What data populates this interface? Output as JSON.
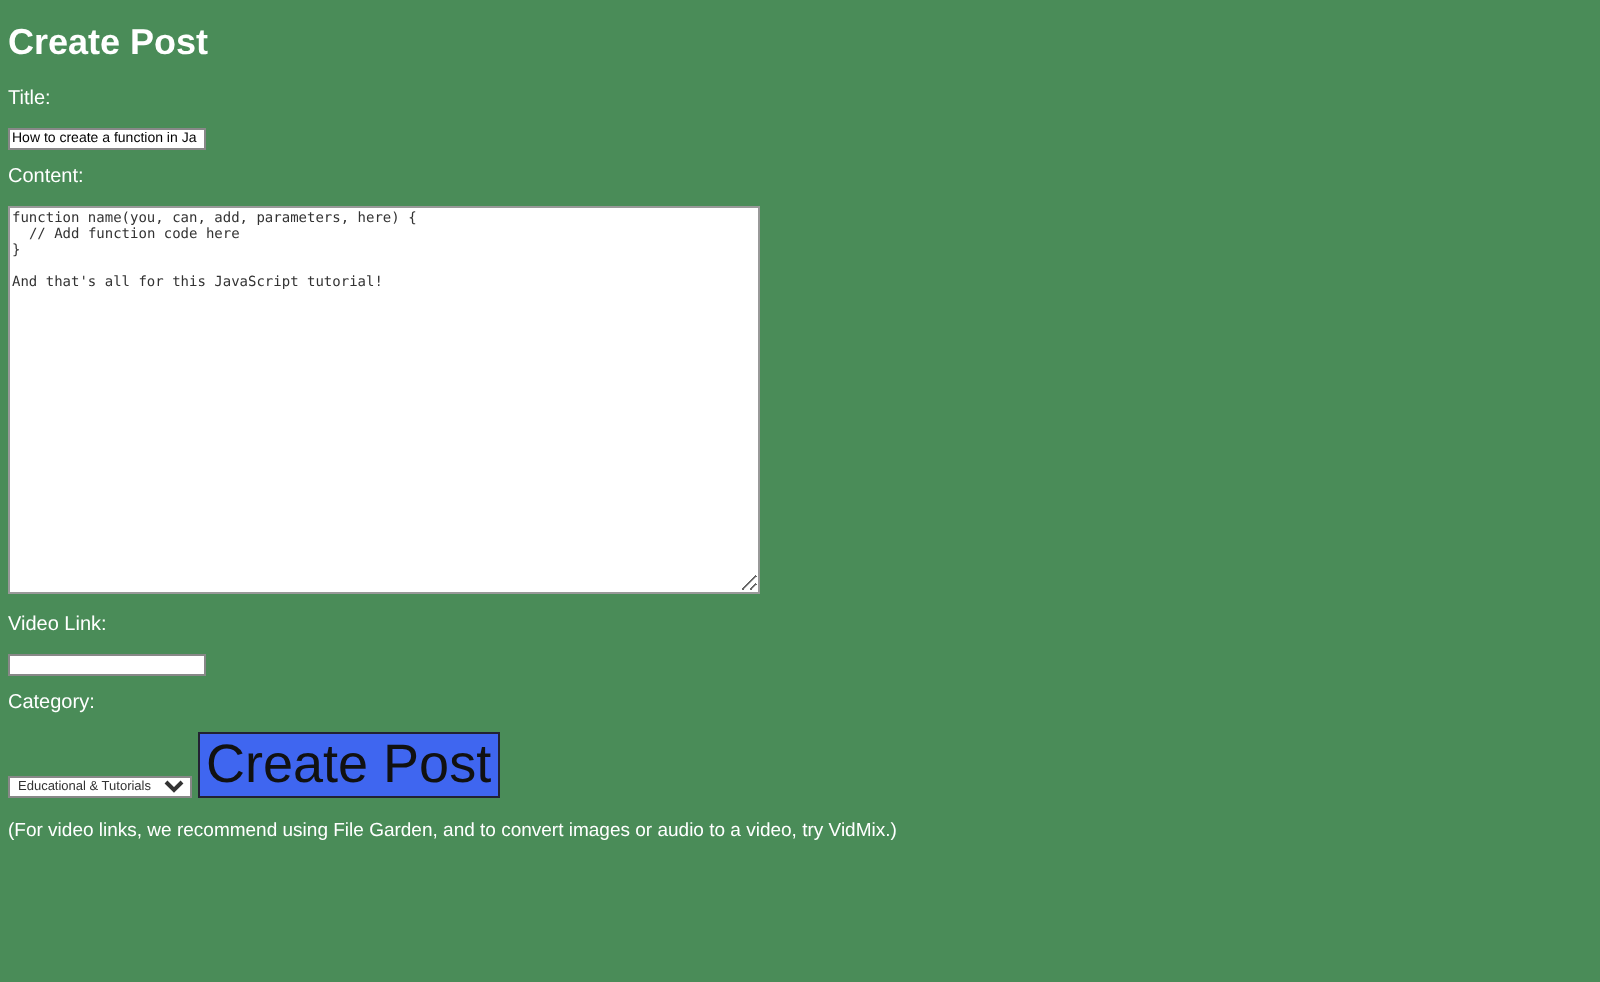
{
  "heading": "Create Post",
  "title_field": {
    "label": "Title:",
    "value": "How to create a function in Ja"
  },
  "content_field": {
    "label": "Content:",
    "value": "function name(you, can, add, parameters, here) {\n  // Add function code here\n}\n\nAnd that's all for this JavaScript tutorial!"
  },
  "video_field": {
    "label": "Video Link:"
  },
  "category_field": {
    "label": "Category:",
    "value": "Educational & Tutorials"
  },
  "submit_button": "Create Post",
  "note": "(For video links, we recommend using File Garden, and to convert images or audio to a video, try VidMix.)"
}
